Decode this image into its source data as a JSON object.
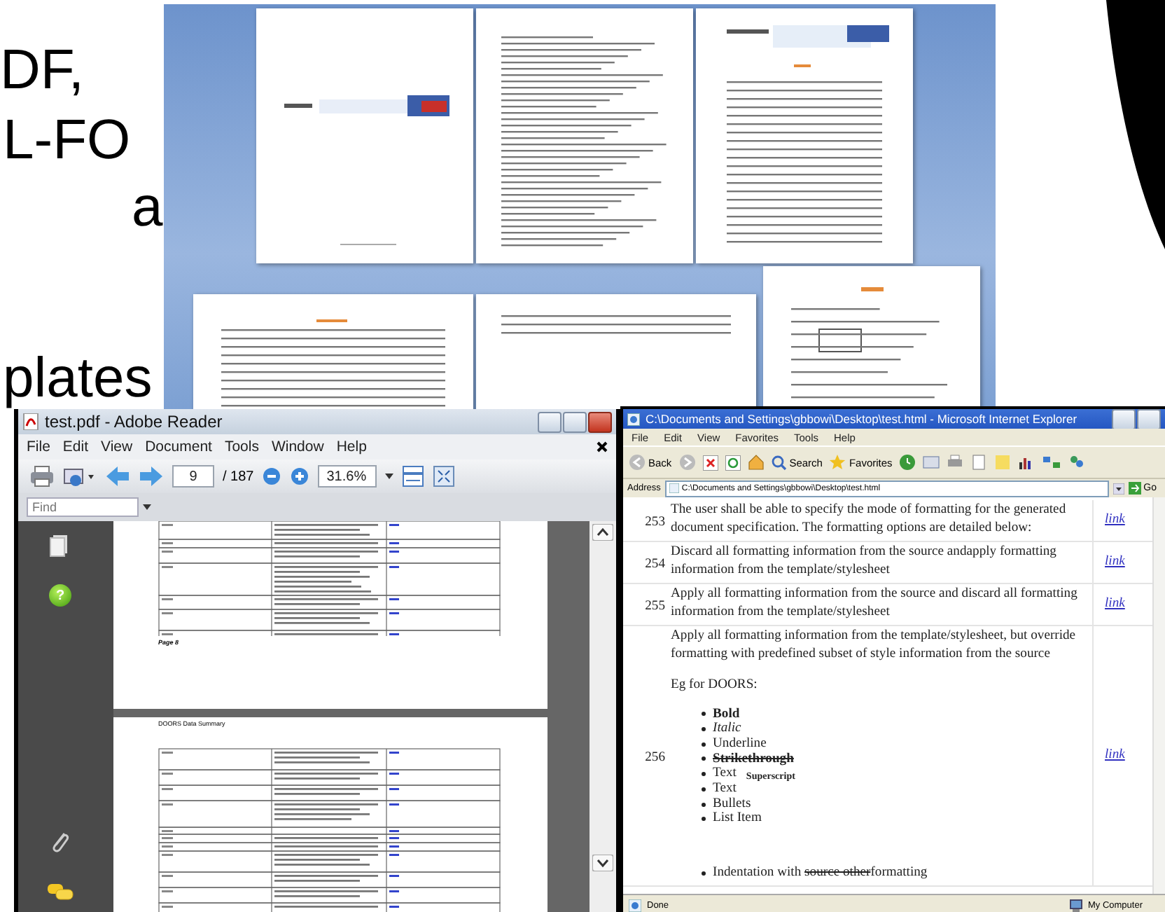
{
  "slide_text": [
    {
      "text": "DF,"
    },
    {
      "text": "L-FO"
    },
    {
      "text": "a"
    },
    {
      "text": "plates"
    }
  ],
  "reader": {
    "title": "test.pdf - Adobe Reader",
    "menu": [
      "File",
      "Edit",
      "View",
      "Document",
      "Tools",
      "Window",
      "Help"
    ],
    "page": "9",
    "page_total": "/ 187",
    "zoom": "31.6%",
    "find_placeholder": "Find",
    "help_glyph": "?",
    "footer": "Page 8",
    "page_heading": "DOORS Data Summary"
  },
  "browser": {
    "title": "C:\\Documents and Settings\\gbbowi\\Desktop\\test.html - Microsoft Internet Explorer",
    "menu": [
      "File",
      "Edit",
      "View",
      "Favorites",
      "Tools",
      "Help"
    ],
    "back": "Back",
    "search": "Search",
    "favorites": "Favorites",
    "address_label": "Address",
    "address": "C:\\Documents and Settings\\gbbowi\\Desktop\\test.html",
    "go": "Go",
    "rows": [
      {
        "number": "253",
        "text": "The user shall be able to specify the mode of formatting for the generated document specification. The formatting options are detailed below:",
        "link": "link"
      },
      {
        "number": "254",
        "text": "Discard all formatting information from the source andapply formatting information from the template/stylesheet",
        "link": "link"
      },
      {
        "number": "255",
        "text": "Apply all formatting information from the source and discard all formatting information from the template/stylesheet",
        "link": "link"
      },
      {
        "number": "256",
        "text": "Apply all formatting information from the template/stylesheet, but override formatting with predefined subset of style information from the source",
        "example": "Eg for DOORS:",
        "link": "link",
        "items": [
          {
            "kind": "bold",
            "text": "Bold"
          },
          {
            "kind": "italic",
            "text": "Italic"
          },
          {
            "kind": "plain",
            "text": "Underline"
          },
          {
            "kind": "strike",
            "text": "Strikethrough"
          },
          {
            "kind": "raised",
            "text": "Text",
            "extra": "Superscript"
          },
          {
            "kind": "plain",
            "text": "Text"
          },
          {
            "kind": "plain",
            "text": "Bullets"
          },
          {
            "kind": "plain",
            "text": "List Item"
          }
        ],
        "last_item": {
          "before": "Indentation with ",
          "struck": "source other",
          "after": "formatting"
        }
      }
    ],
    "status": "Done",
    "zone": "My Computer"
  }
}
